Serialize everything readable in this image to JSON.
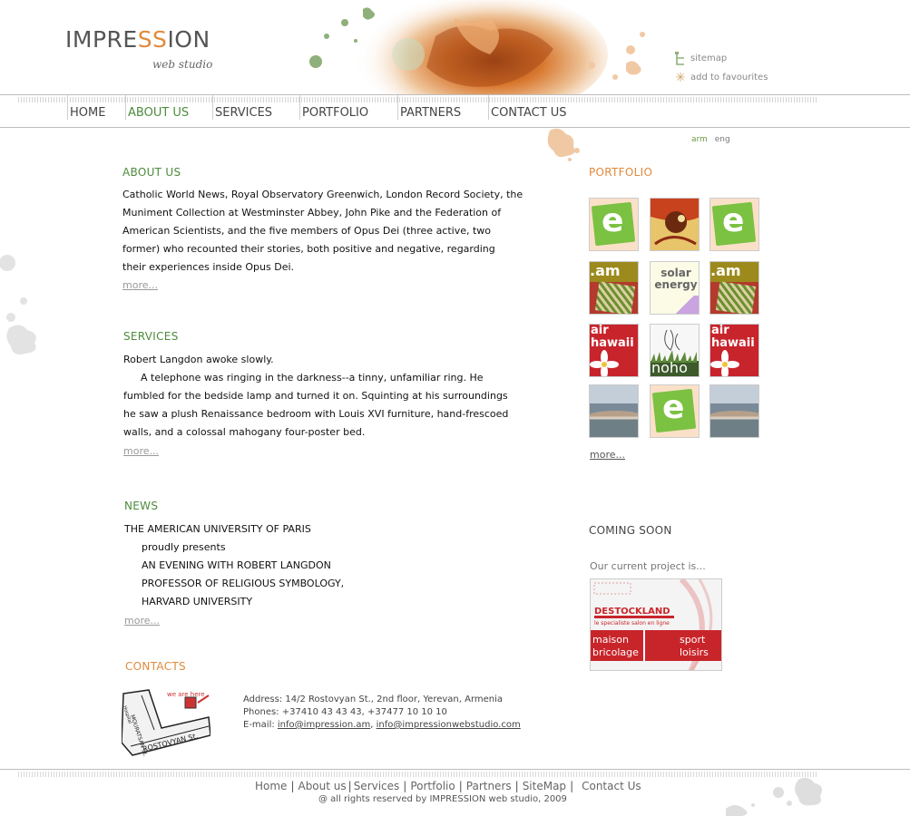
{
  "logo": {
    "name_part1": "IMPRE",
    "name_ss": "SS",
    "name_part2": "ION",
    "tagline": "web studio"
  },
  "util_links": [
    {
      "label": "sitemap",
      "icon": "sitemap-icon"
    },
    {
      "label": "add to favourites",
      "icon": "star-icon"
    }
  ],
  "nav": [
    {
      "label": "HOME"
    },
    {
      "label": "ABOUT US"
    },
    {
      "label": "SERVICES"
    },
    {
      "label": "PORTFOLIO"
    },
    {
      "label": "PARTNERS"
    },
    {
      "label": "CONTACT US"
    }
  ],
  "lang": {
    "arm": "arm",
    "eng": "eng"
  },
  "about": {
    "title": "ABOUT US",
    "lines": [
      "Catholic World News, Royal Observatory Greenwich, London Record Society, the",
      "Muniment Collection  at Westminster  Abbey, John Pike  and the Federation of",
      "American Scientists, and the five  members of  Opus  Dei (three active,  two",
      "former) who recounted their  stories, both positive and negative,  regarding",
      "their experiences inside Opus Dei."
    ],
    "more": "more..."
  },
  "services": {
    "title": "SERVICES",
    "lines": [
      "Robert Langdon awoke slowly.",
      "A telephone was ringing in  the darkness--a tinny, unfamiliar  ring. He",
      "fumbled for the bedside lamp and turned it on. Squinting at his surroundings",
      "he saw a plush Renaissance bedroom  with Louis  XVI furniture, hand-frescoed",
      "walls, and a colossal mahogany four-poster bed."
    ],
    "more": "more..."
  },
  "news": {
    "title": "NEWS",
    "lines": [
      "THE AMERICAN UNIVERSITY OF PARIS",
      "proudly presents",
      "AN EVENING WITH ROBERT LANGDON",
      "PROFESSOR OF RELIGIOUS SYMBOLOGY,",
      "HARVARD UNIVERSITY"
    ],
    "more": "more..."
  },
  "contacts": {
    "title": "CONTACTS",
    "map_labels": {
      "here": "we are here",
      "street1": "MOURATSAN St.",
      "street2": "ROSTOVYAN St.",
      "hospital": "Hospital"
    },
    "address": "Address: 14/2 Rostovyan St., 2nd floor, Yerevan, Armenia",
    "phones": "Phones: +37410 43 43 43, +37477 10 10 10",
    "email_prefix": "E-mail: ",
    "email1": "info@impression.am",
    "email_sep": ", ",
    "email2": "info@impressionwebstudio.com"
  },
  "portfolio": {
    "title": "PORTFOLIO",
    "thumbs": [
      {
        "kind": "e",
        "text": "e"
      },
      {
        "kind": "art",
        "text": ""
      },
      {
        "kind": "e",
        "text": "e"
      },
      {
        "kind": "am",
        "text": ".am"
      },
      {
        "kind": "solar",
        "text": "solar energy"
      },
      {
        "kind": "am",
        "text": ".am"
      },
      {
        "kind": "hawaii",
        "text": "air hawaii"
      },
      {
        "kind": "noho",
        "text": "noho"
      },
      {
        "kind": "hawaii",
        "text": "air hawaii"
      },
      {
        "kind": "fountain",
        "text": ""
      },
      {
        "kind": "e",
        "text": "e"
      },
      {
        "kind": "fountain",
        "text": ""
      }
    ],
    "more": "more..."
  },
  "coming": {
    "title": "COMING SOON",
    "subtitle": "Our current project is...",
    "ad": {
      "brand": "DESTOCKLAND",
      "tagline": "le specialiste salon en ligne",
      "left": "maison bricolage",
      "right": "sport loisirs"
    }
  },
  "footer": {
    "links": [
      "Home",
      "About us",
      "Services",
      "Portfolio",
      "Partners",
      "SiteMap",
      "Contact Us"
    ],
    "copyright": "@ all rights reserved by IMPRESSION web studio, 2009"
  },
  "colors": {
    "green": "#4d8b3c",
    "orange": "#e08a3c",
    "text": "#111111",
    "muted": "#999999"
  }
}
